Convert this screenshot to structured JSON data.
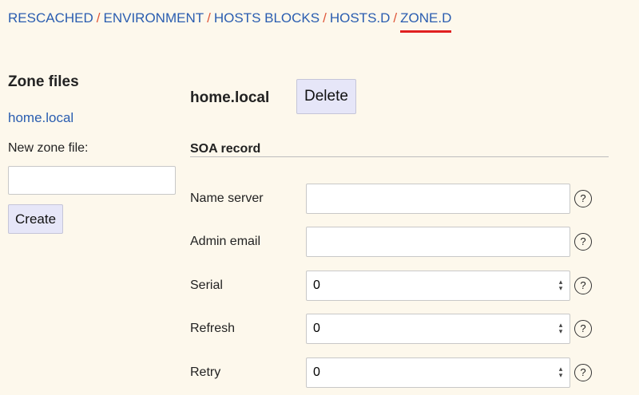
{
  "breadcrumb": {
    "items": [
      "RESCACHED",
      "ENVIRONMENT",
      "HOSTS BLOCKS",
      "HOSTS.D",
      "ZONE.D"
    ],
    "separator": "/"
  },
  "sidebar": {
    "title": "Zone files",
    "zones": [
      "home.local"
    ],
    "new_zone_label": "New zone file:",
    "new_zone_value": "",
    "create_label": "Create"
  },
  "main": {
    "zone_title": "home.local",
    "delete_label": "Delete",
    "soa_title": "SOA record",
    "fields": [
      {
        "label": "Name server",
        "value": "",
        "type": "text"
      },
      {
        "label": "Admin email",
        "value": "",
        "type": "text"
      },
      {
        "label": "Serial",
        "value": "0",
        "type": "number"
      },
      {
        "label": "Refresh",
        "value": "0",
        "type": "number"
      },
      {
        "label": "Retry",
        "value": "0",
        "type": "number"
      }
    ],
    "help_glyph": "?"
  },
  "colors": {
    "background": "#fdf8ec",
    "link": "#2a5db0",
    "separator": "#e0573a",
    "active_underline": "#e02020",
    "button": "#e6e6f8"
  }
}
